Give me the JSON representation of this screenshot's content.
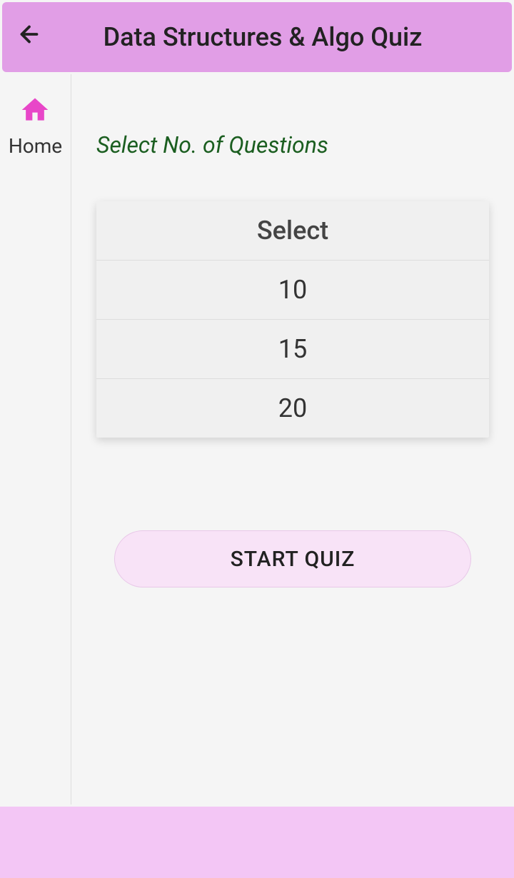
{
  "header": {
    "title": "Data Structures & Algo Quiz"
  },
  "sidebar": {
    "home_label": "Home"
  },
  "main": {
    "prompt": "Select No. of Questions",
    "select_header": "Select",
    "options": [
      "10",
      "15",
      "20"
    ],
    "start_button": "START QUIZ"
  }
}
